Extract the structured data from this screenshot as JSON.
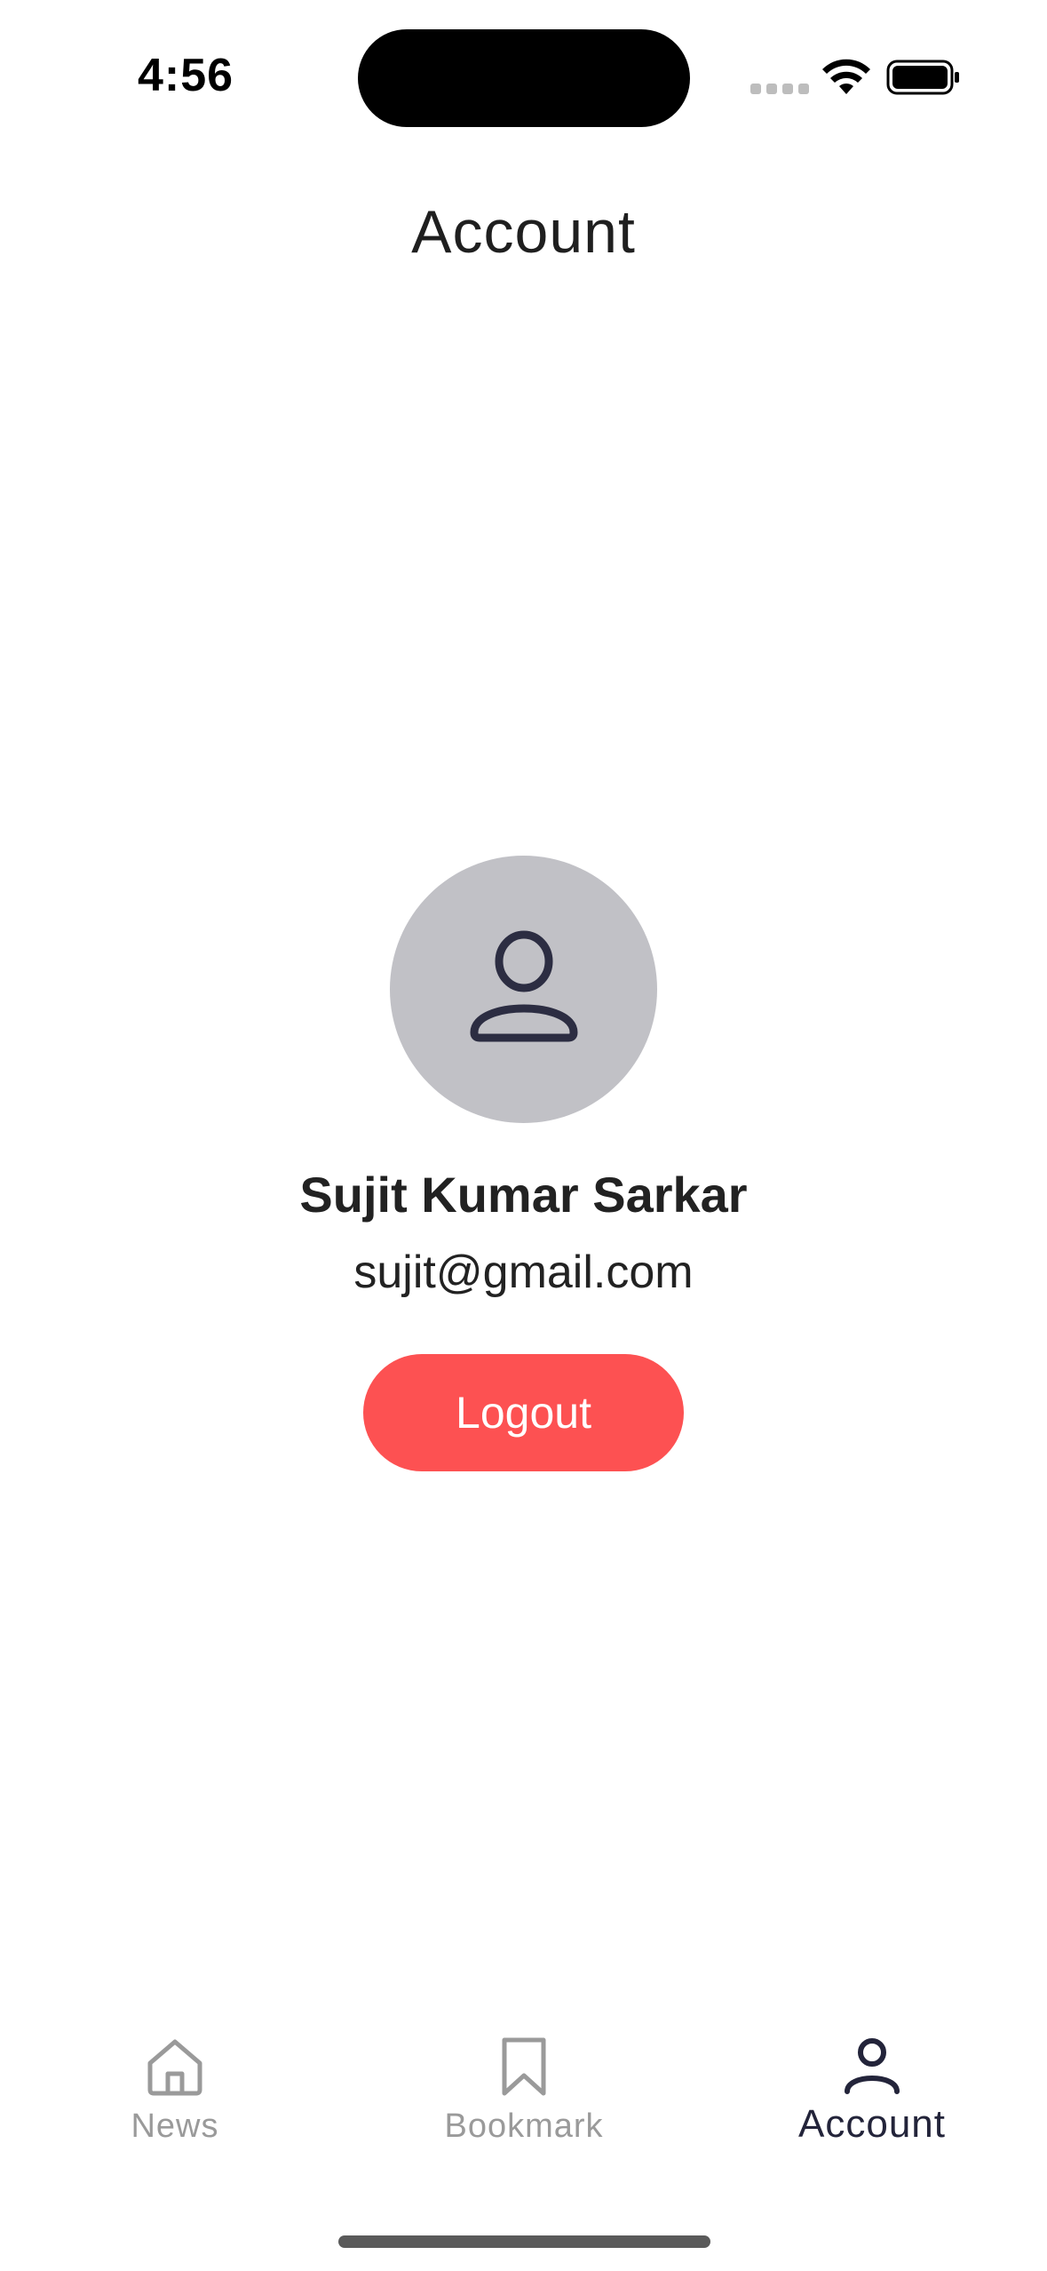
{
  "status_bar": {
    "time": "4:56"
  },
  "header": {
    "title": "Account"
  },
  "profile": {
    "avatar_icon": "user-icon",
    "name": "Sujit Kumar Sarkar",
    "email": "sujit@gmail.com",
    "logout_label": "Logout"
  },
  "bottom_nav": {
    "items": [
      {
        "label": "News",
        "icon": "home-icon",
        "active": false
      },
      {
        "label": "Bookmark",
        "icon": "bookmark-icon",
        "active": false
      },
      {
        "label": "Account",
        "icon": "user-icon",
        "active": true
      }
    ]
  },
  "colors": {
    "accent": "#fd5152",
    "avatar_bg": "#c1c1c6",
    "active_nav": "#23243a",
    "inactive_nav": "#9a9a9a"
  }
}
